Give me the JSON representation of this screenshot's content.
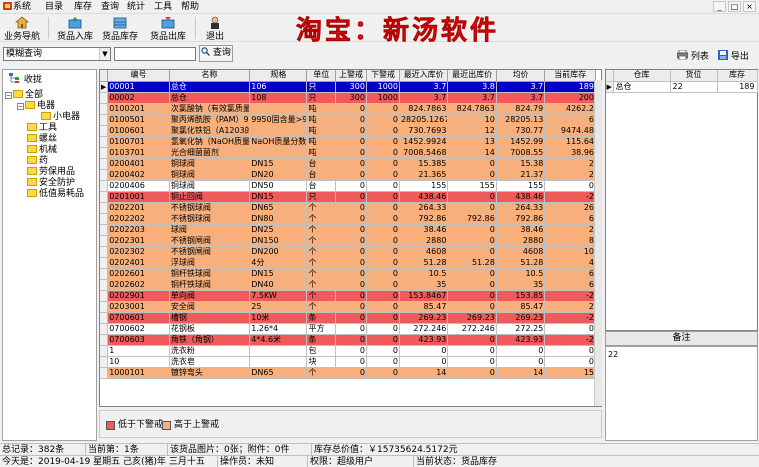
{
  "menu": [
    "系统",
    "目录",
    "库存",
    "查询",
    "统计",
    "工具",
    "帮助"
  ],
  "window_controls": [
    "_",
    "□",
    "×"
  ],
  "toolbar": {
    "nav": "业务导航",
    "in": "货品入库",
    "stock": "货品库存",
    "out": "货品出库",
    "exit": "退出"
  },
  "brand": "淘宝：新汤软件",
  "query": {
    "mode": "模糊查询",
    "button": "查询",
    "value": ""
  },
  "actions": {
    "list": "列表",
    "export": "导出"
  },
  "tree": {
    "root_label": "收拢",
    "nodes": [
      "全部",
      "电器",
      "小电器",
      "工具",
      "螺丝",
      "机械",
      "药",
      "劳保用品",
      "安全防护",
      "低值易耗品"
    ]
  },
  "grid": {
    "columns": [
      "编号",
      "名称",
      "规格",
      "单位",
      "上警戒",
      "下警戒",
      "最近入库价",
      "最近出库价",
      "均价",
      "当前库存"
    ],
    "rows": [
      {
        "c": "sel",
        "v": [
          "00001",
          "总仓",
          "106",
          "只",
          "300",
          "1000",
          "3.7",
          "3.8",
          "3.7",
          "189"
        ]
      },
      {
        "c": "r",
        "v": [
          "00002",
          "总仓",
          "108",
          "只",
          "300",
          "1000",
          "3.7",
          "3.7",
          "3.7",
          "200"
        ]
      },
      {
        "c": "o",
        "v": [
          "0100201",
          "次氯酸钠（有效氯质量分数",
          "",
          "吨",
          "0",
          "0",
          "824.7863",
          "824.7863",
          "824.79",
          "4262.2"
        ]
      },
      {
        "c": "o",
        "v": [
          "0100501",
          "聚丙烯酰胺（PAM）9950固",
          "9950固含量>90",
          "吨",
          "0",
          "0",
          "28205.1267",
          "10",
          "28205.13",
          "6"
        ]
      },
      {
        "c": "o",
        "v": [
          "0100601",
          "聚氯化铁铝（A1203的质量",
          "",
          "吨",
          "0",
          "0",
          "730.7693",
          "12",
          "730.77",
          "9474.48"
        ]
      },
      {
        "c": "o",
        "v": [
          "0100701",
          "氢氧化钠（NaOH质量分数",
          "NaOH质量分数",
          "吨",
          "0",
          "0",
          "1452.9924",
          "13",
          "1452.99",
          "115.64"
        ]
      },
      {
        "c": "o",
        "v": [
          "0103701",
          "光合细菌菌剂",
          "",
          "吨",
          "0",
          "0",
          "7008.5468",
          "14",
          "7008.55",
          "38.96"
        ]
      },
      {
        "c": "o",
        "v": [
          "0200401",
          "铜球阀",
          "DN15",
          "台",
          "0",
          "0",
          "15.385",
          "0",
          "15.38",
          "2"
        ]
      },
      {
        "c": "o",
        "v": [
          "0200402",
          "铜球阀",
          "DN20",
          "台",
          "0",
          "0",
          "21.365",
          "0",
          "21.37",
          "2"
        ]
      },
      {
        "c": "w",
        "v": [
          "0200406",
          "铜球阀",
          "DN50",
          "台",
          "0",
          "0",
          "155",
          "155",
          "155",
          "0"
        ]
      },
      {
        "c": "r",
        "v": [
          "0201001",
          "铜止回阀",
          "DN15",
          "只",
          "0",
          "0",
          "438.46",
          "0",
          "438.46",
          "-2"
        ]
      },
      {
        "c": "o",
        "v": [
          "0202201",
          "不锈钢球阀",
          "DN65",
          "个",
          "0",
          "0",
          "264.33",
          "0",
          "264.33",
          "26"
        ]
      },
      {
        "c": "o",
        "v": [
          "0202202",
          "不锈钢球阀",
          "DN80",
          "个",
          "0",
          "0",
          "792.86",
          "792.86",
          "792.86",
          "6"
        ]
      },
      {
        "c": "o",
        "v": [
          "0202203",
          "球阀",
          "DN25",
          "个",
          "0",
          "0",
          "38.46",
          "0",
          "38.46",
          "2"
        ]
      },
      {
        "c": "o",
        "v": [
          "0202301",
          "不锈钢闸阀",
          "DN150",
          "个",
          "0",
          "0",
          "2880",
          "0",
          "2880",
          "8"
        ]
      },
      {
        "c": "o",
        "v": [
          "0202302",
          "不锈钢闸阀",
          "DN200",
          "个",
          "0",
          "0",
          "4608",
          "0",
          "4608",
          "10"
        ]
      },
      {
        "c": "o",
        "v": [
          "0202401",
          "浮球阀",
          "4分",
          "个",
          "0",
          "0",
          "51.28",
          "51.28",
          "51.28",
          "4"
        ]
      },
      {
        "c": "o",
        "v": [
          "0202601",
          "铜杆铁球阀",
          "DN15",
          "个",
          "0",
          "0",
          "10.5",
          "0",
          "10.5",
          "6"
        ]
      },
      {
        "c": "o",
        "v": [
          "0202602",
          "铜杆铁球阀",
          "DN40",
          "个",
          "0",
          "0",
          "35",
          "0",
          "35",
          "6"
        ]
      },
      {
        "c": "r",
        "v": [
          "0202901",
          "单向阀",
          "7.5KW",
          "个",
          "0",
          "0",
          "153.8467",
          "0",
          "153.85",
          "-2"
        ]
      },
      {
        "c": "o",
        "v": [
          "0203001",
          "安全阀",
          "25",
          "个",
          "0",
          "0",
          "85.47",
          "0",
          "85.47",
          "2"
        ]
      },
      {
        "c": "r",
        "v": [
          "0700601",
          "槽钢",
          "10米",
          "条",
          "0",
          "0",
          "269.23",
          "269.23",
          "269.23",
          "-2"
        ]
      },
      {
        "c": "w",
        "v": [
          "0700602",
          "花钢板",
          "1.26*4",
          "平方",
          "0",
          "0",
          "272.246",
          "272.246",
          "272.25",
          "0"
        ]
      },
      {
        "c": "r",
        "v": [
          "0700603",
          "角铁（角钢）",
          "4*4.6米",
          "条",
          "0",
          "0",
          "423.93",
          "0",
          "423.93",
          "-2"
        ]
      },
      {
        "c": "w",
        "v": [
          "1",
          "洗衣粉",
          "",
          "包",
          "0",
          "0",
          "0",
          "0",
          "0",
          "0"
        ]
      },
      {
        "c": "w",
        "v": [
          "10",
          "洗衣皂",
          "",
          "块",
          "0",
          "0",
          "0",
          "0",
          "0",
          "0"
        ]
      },
      {
        "c": "o",
        "v": [
          "1000101",
          "镀锌弯头",
          "DN65",
          "个",
          "0",
          "0",
          "14",
          "0",
          "14",
          "15"
        ]
      }
    ]
  },
  "legend": {
    "low": "低于下警戒",
    "high": "高于上警戒",
    "low_color": "#f15a5a",
    "high_color": "#f7b07b"
  },
  "warehouse": {
    "columns": [
      "仓库",
      "货位",
      "库存"
    ],
    "rows": [
      [
        "总仓",
        "22",
        "189"
      ]
    ]
  },
  "note": {
    "title": "备注",
    "text": "22"
  },
  "status": {
    "total": "总记录：382条",
    "current": "当前第：1条",
    "images": "该货品图片：0张；附件：0件",
    "value": "库存总价值：￥15735624.5172元",
    "today": "今天是：2019-04-19 星期五 己亥(猪)年 三月十五",
    "operator": "操作员：未知",
    "permission": "权限：超级用户",
    "state": "当前状态：货品库存"
  }
}
